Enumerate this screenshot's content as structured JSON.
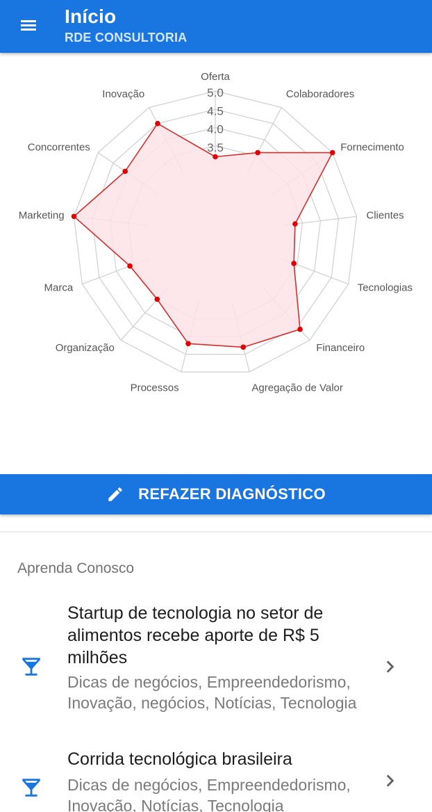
{
  "appbar": {
    "title": "Início",
    "subtitle": "RDE CONSULTORIA",
    "menu_icon": "menu-icon"
  },
  "chart_data": {
    "type": "radar",
    "categories": [
      "Oferta",
      "Colaboradores",
      "Fornecimento",
      "Clientes",
      "Tecnologias",
      "Financeiro",
      "Agregação de Valor",
      "Processos",
      "Organização",
      "Marca",
      "Marketing",
      "Concorrentes",
      "Inovação"
    ],
    "values": [
      3.2,
      3.6,
      5.0,
      3.3,
      3.4,
      4.6,
      4.3,
      4.2,
      3.5,
      3.6,
      5.0,
      4.1,
      4.5
    ],
    "ticks": [
      "3.5",
      "4.0",
      "4.5",
      "5.0"
    ],
    "rlim": [
      3.0,
      5.0
    ],
    "colors": {
      "fill": "#fde3e7",
      "line": "#d32f2f",
      "point": "#e00000",
      "grid": "#cfcfcf"
    }
  },
  "redo_button": {
    "label": "REFAZER DIAGNÓSTICO",
    "icon": "pencil-icon"
  },
  "learn": {
    "title": "Aprenda Conosco",
    "articles": [
      {
        "title": "Startup de tecnologia no setor de alimentos recebe aporte de R$ 5 milhões",
        "tags": "Dicas de negócios, Empreendedorismo, Inovação, negócios, Notícias, Tecnologia",
        "icon": "cocktail-glass-icon"
      },
      {
        "title": "Corrida tecnológica brasileira",
        "tags": "Dicas de negócios, Empreendedorismo, Inovação, Notícias, Tecnologia",
        "icon": "cocktail-glass-icon"
      }
    ]
  },
  "theme": {
    "primary": "#1976e0"
  }
}
